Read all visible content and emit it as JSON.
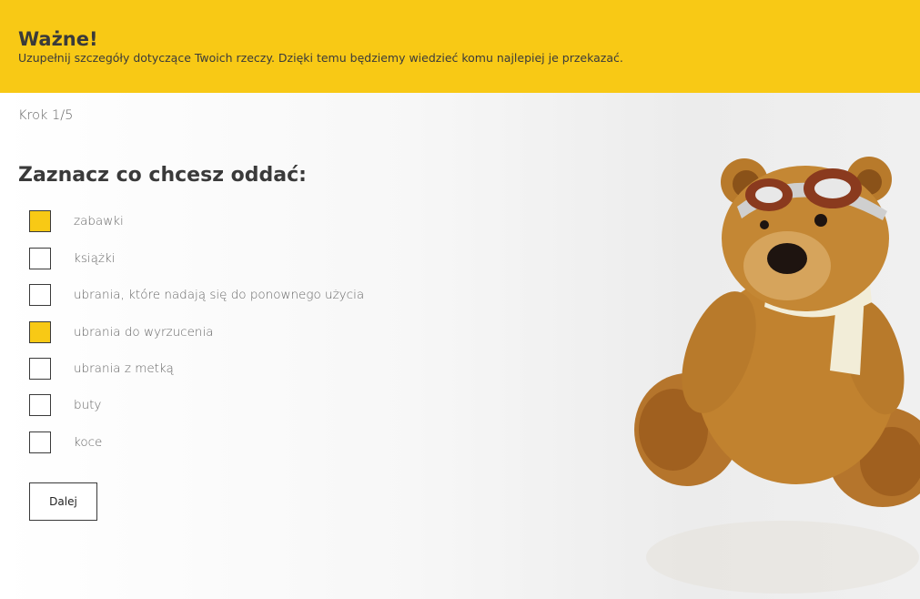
{
  "banner": {
    "title": "Ważne!",
    "text": "Uzupełnij szczegóły dotyczące Twoich rzeczy. Dzięki temu będziemy wiedzieć komu najlepiej je przekazać."
  },
  "form": {
    "step": "Krok 1/5",
    "heading": "Zaznacz co chcesz oddać:",
    "options": [
      {
        "label": "zabawki",
        "checked": true
      },
      {
        "label": "książki",
        "checked": false
      },
      {
        "label": "ubrania, które nadają się do ponownego użycia",
        "checked": false
      },
      {
        "label": "ubrania do wyrzucenia",
        "checked": true
      },
      {
        "label": "ubrania z metką",
        "checked": false
      },
      {
        "label": "buty",
        "checked": false
      },
      {
        "label": "koce",
        "checked": false
      }
    ],
    "next_label": "Dalej"
  },
  "colors": {
    "accent": "#f8c915",
    "text": "#3a3a3a"
  },
  "image": {
    "name": "teddy-bear-illustration"
  }
}
